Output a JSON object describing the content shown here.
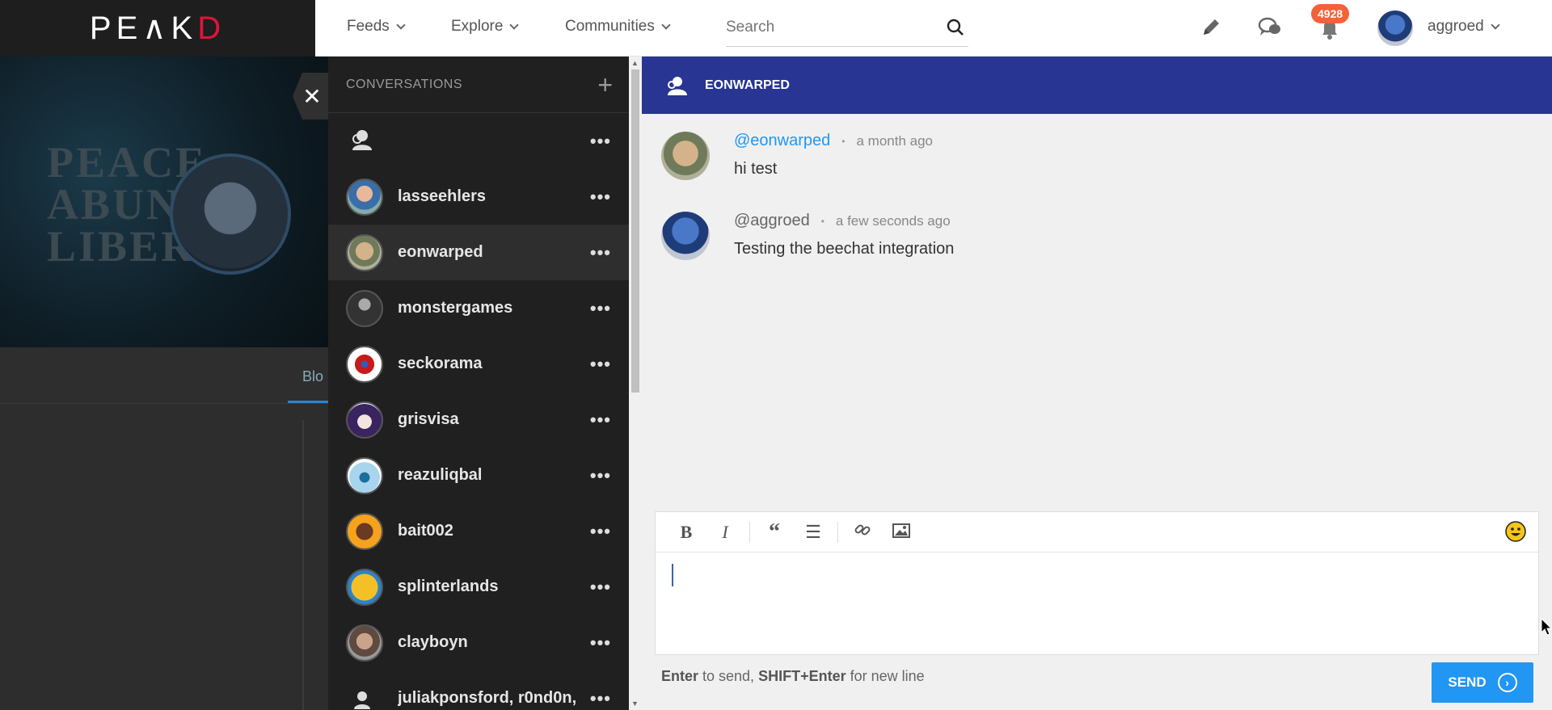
{
  "logo": {
    "prefix": "PE",
    "mid": "∧",
    "k": "K",
    "d": "D"
  },
  "nav": {
    "feeds": "Feeds",
    "explore": "Explore",
    "communities": "Communities",
    "search_placeholder": "Search"
  },
  "notifications": {
    "count": "4928"
  },
  "user": {
    "name": "aggroed"
  },
  "profile_bg": {
    "cover_text": "PEACE\nABUN\nLIBER",
    "tab": "Blo"
  },
  "conversations": {
    "title": "CONVERSATIONS",
    "plus": "+",
    "items": [
      {
        "name": "",
        "type": "group"
      },
      {
        "name": "lasseehlers"
      },
      {
        "name": "eonwarped",
        "active": true
      },
      {
        "name": "monstergames"
      },
      {
        "name": "seckorama"
      },
      {
        "name": "grisvisa"
      },
      {
        "name": "reazuliqbal"
      },
      {
        "name": "bait002"
      },
      {
        "name": "splinterlands"
      },
      {
        "name": "clayboyn"
      },
      {
        "name": "juliakponsford, r0nd0n,"
      }
    ]
  },
  "chat": {
    "title": "EONWARPED",
    "messages": [
      {
        "user": "@eonwarped",
        "time": "a month ago",
        "text": "hi test",
        "color": "#2196f3"
      },
      {
        "user": "@aggroed",
        "time": "a few seconds ago",
        "text": "Testing the beechat integration",
        "color": "#666666"
      }
    ],
    "hint_enter": "Enter",
    "hint_mid": " to send, ",
    "hint_shift": "SHIFT+Enter",
    "hint_end": " for new line",
    "send_label": "SEND"
  },
  "colors": {
    "accent": "#283593",
    "button": "#2196f3",
    "badge": "#f4623a",
    "brand_red": "#e31337"
  }
}
